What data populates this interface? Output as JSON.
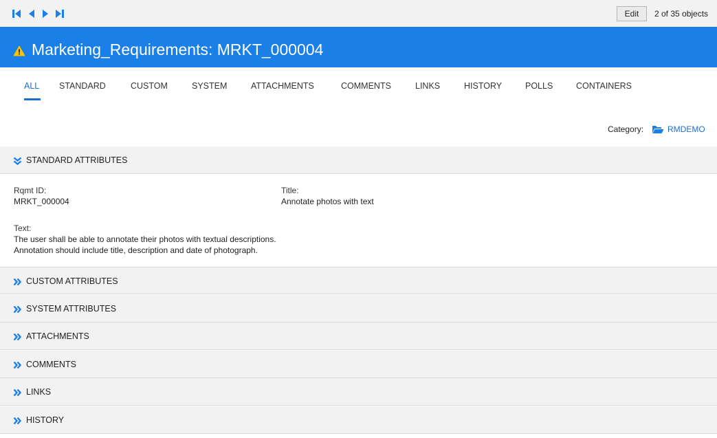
{
  "toolbar": {
    "nav_buttons": [
      {
        "name": "first-record-icon"
      },
      {
        "name": "previous-record-icon"
      },
      {
        "name": "next-record-icon"
      },
      {
        "name": "last-record-icon"
      }
    ],
    "edit_label": "Edit",
    "object_count": "2 of 35 objects"
  },
  "header": {
    "icon": "warning-icon",
    "title": "Marketing_Requirements: MRKT_000004"
  },
  "tabs": [
    {
      "label": "ALL",
      "active": true
    },
    {
      "label": "STANDARD"
    },
    {
      "label": "CUSTOM"
    },
    {
      "label": "SYSTEM"
    },
    {
      "label": "ATTACHMENTS"
    },
    {
      "label": "COMMENTS"
    },
    {
      "label": "LINKS"
    },
    {
      "label": "HISTORY"
    },
    {
      "label": "POLLS"
    },
    {
      "label": "CONTAINERS"
    }
  ],
  "category": {
    "label": "Category:",
    "icon": "folder-open-icon",
    "value": "RMDEMO"
  },
  "standard_attributes": {
    "title": "STANDARD ATTRIBUTES",
    "expanded": true,
    "rqmt_id_label": "Rqmt ID:",
    "rqmt_id_value": "MRKT_000004",
    "title_label": "Title:",
    "title_value": "Annotate photos with text",
    "text_label": "Text:",
    "text_line1": "The user shall be able to annotate their photos with textual descriptions.",
    "text_line2": "Annotation should include title, description and date  of photograph."
  },
  "collapsed_sections": [
    {
      "title": "CUSTOM ATTRIBUTES"
    },
    {
      "title": "SYSTEM ATTRIBUTES"
    },
    {
      "title": "ATTACHMENTS"
    },
    {
      "title": "COMMENTS"
    },
    {
      "title": "LINKS"
    },
    {
      "title": "HISTORY"
    }
  ],
  "colors": {
    "accent": "#1a7fe6",
    "link": "#1a6fd0",
    "warning": "#f5c400",
    "section_bg": "#f2f2f2"
  }
}
